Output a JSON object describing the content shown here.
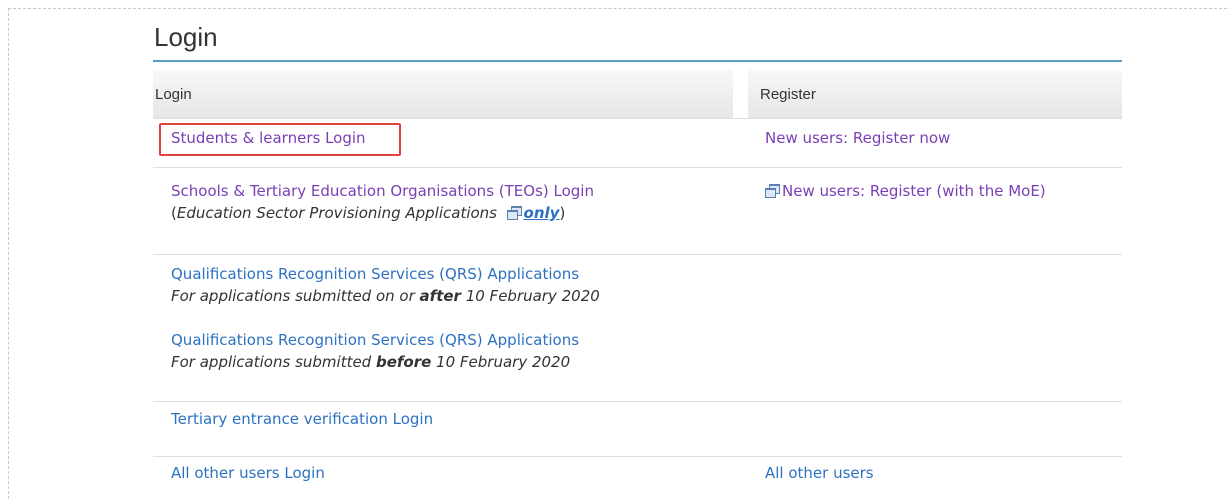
{
  "page": {
    "title": "Login"
  },
  "columns": {
    "login_header": "Login",
    "register_header": "Register"
  },
  "rows": [
    {
      "login_label": "Students & learners Login",
      "register_label": "New users: Register now"
    },
    {
      "login_label": "Schools & Tertiary Education Organisations (TEOs) Login",
      "note_open": "(",
      "note_text": "Education Sector Provisioning Applications",
      "note_only": "only",
      "note_close": ")",
      "register_label": "New users: Register (with the MoE)"
    },
    {
      "qrs_after_label": "Qualifications Recognition Services (QRS) Applications",
      "qrs_after_note_a": "For applications submitted on or ",
      "qrs_after_note_b": "after",
      "qrs_after_note_c": " 10 February 2020",
      "qrs_before_label": "Qualifications Recognition Services (QRS) Applications",
      "qrs_before_note_a": "For applications submitted ",
      "qrs_before_note_b": "before",
      "qrs_before_note_c": " 10 February 2020"
    },
    {
      "login_label": "Tertiary entrance verification Login"
    },
    {
      "login_label": "All other users Login",
      "register_label": "All other users"
    }
  ],
  "icons": {
    "external": "external-window-icon"
  },
  "colors": {
    "link": "#2d72c2",
    "visited_link": "#7a3fb5",
    "rule": "#5a9bc8",
    "highlight": "#e0403c"
  }
}
